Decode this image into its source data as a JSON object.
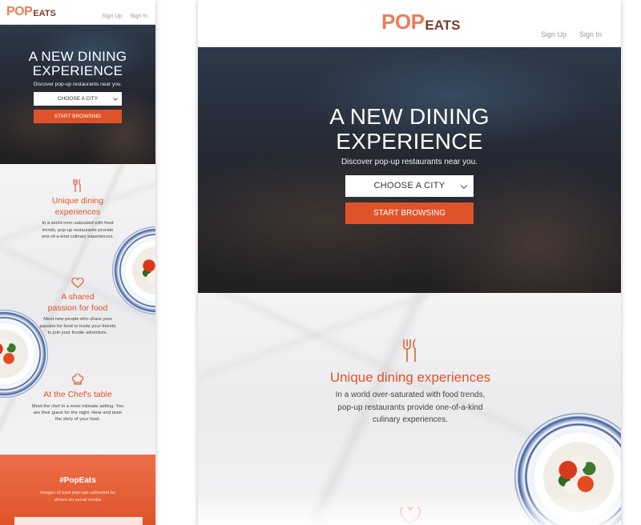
{
  "brand": {
    "logo_pop": "POP",
    "logo_eats": "EATS"
  },
  "nav": {
    "sign_up": "Sign Up",
    "sign_in": "Sign In"
  },
  "hero": {
    "title_line1": "A NEW DINING",
    "title_line2": "EXPERIENCE",
    "subtitle": "Discover pop-up restaurants near you.",
    "city_select": "CHOOSE A CITY",
    "cta": "START BROWSING"
  },
  "features": [
    {
      "icon": "fork-knife-icon",
      "title_mobile_l1": "Unique dining",
      "title_mobile_l2": "experiences",
      "title": "Unique dining experiences",
      "text_mobile": [
        "In a world over-saturated with food",
        "trends, pop-up restaurants provide",
        "one-of-a-kind culinary experiences."
      ],
      "text_desktop": [
        "In a world over-saturated with food trends,",
        "pop-up restaurants provide one-of-a-kind",
        "culinary experiences."
      ]
    },
    {
      "icon": "heart-hands-icon",
      "title_mobile_l1": "A shared",
      "title_mobile_l2": "passion for food",
      "text_mobile": [
        "Meet new people who share your",
        "passion for food or invite your friends",
        "to join your foodie adventure."
      ]
    },
    {
      "icon": "chef-hat-icon",
      "title_mobile_l1": "At the Chef's table",
      "text_mobile": [
        "Meet the chef in a more intimate setting. You",
        "are their guest for the night. Hear and taste",
        "the story of your food."
      ]
    }
  ],
  "social": {
    "title": "#PopEats",
    "text_l1": "Images of past pop-ups uploaded by",
    "text_l2": "diners on social media"
  },
  "colors": {
    "accent": "#e0532a",
    "logo_pop": "#ee7c57",
    "logo_eats": "#7a3a2a"
  }
}
